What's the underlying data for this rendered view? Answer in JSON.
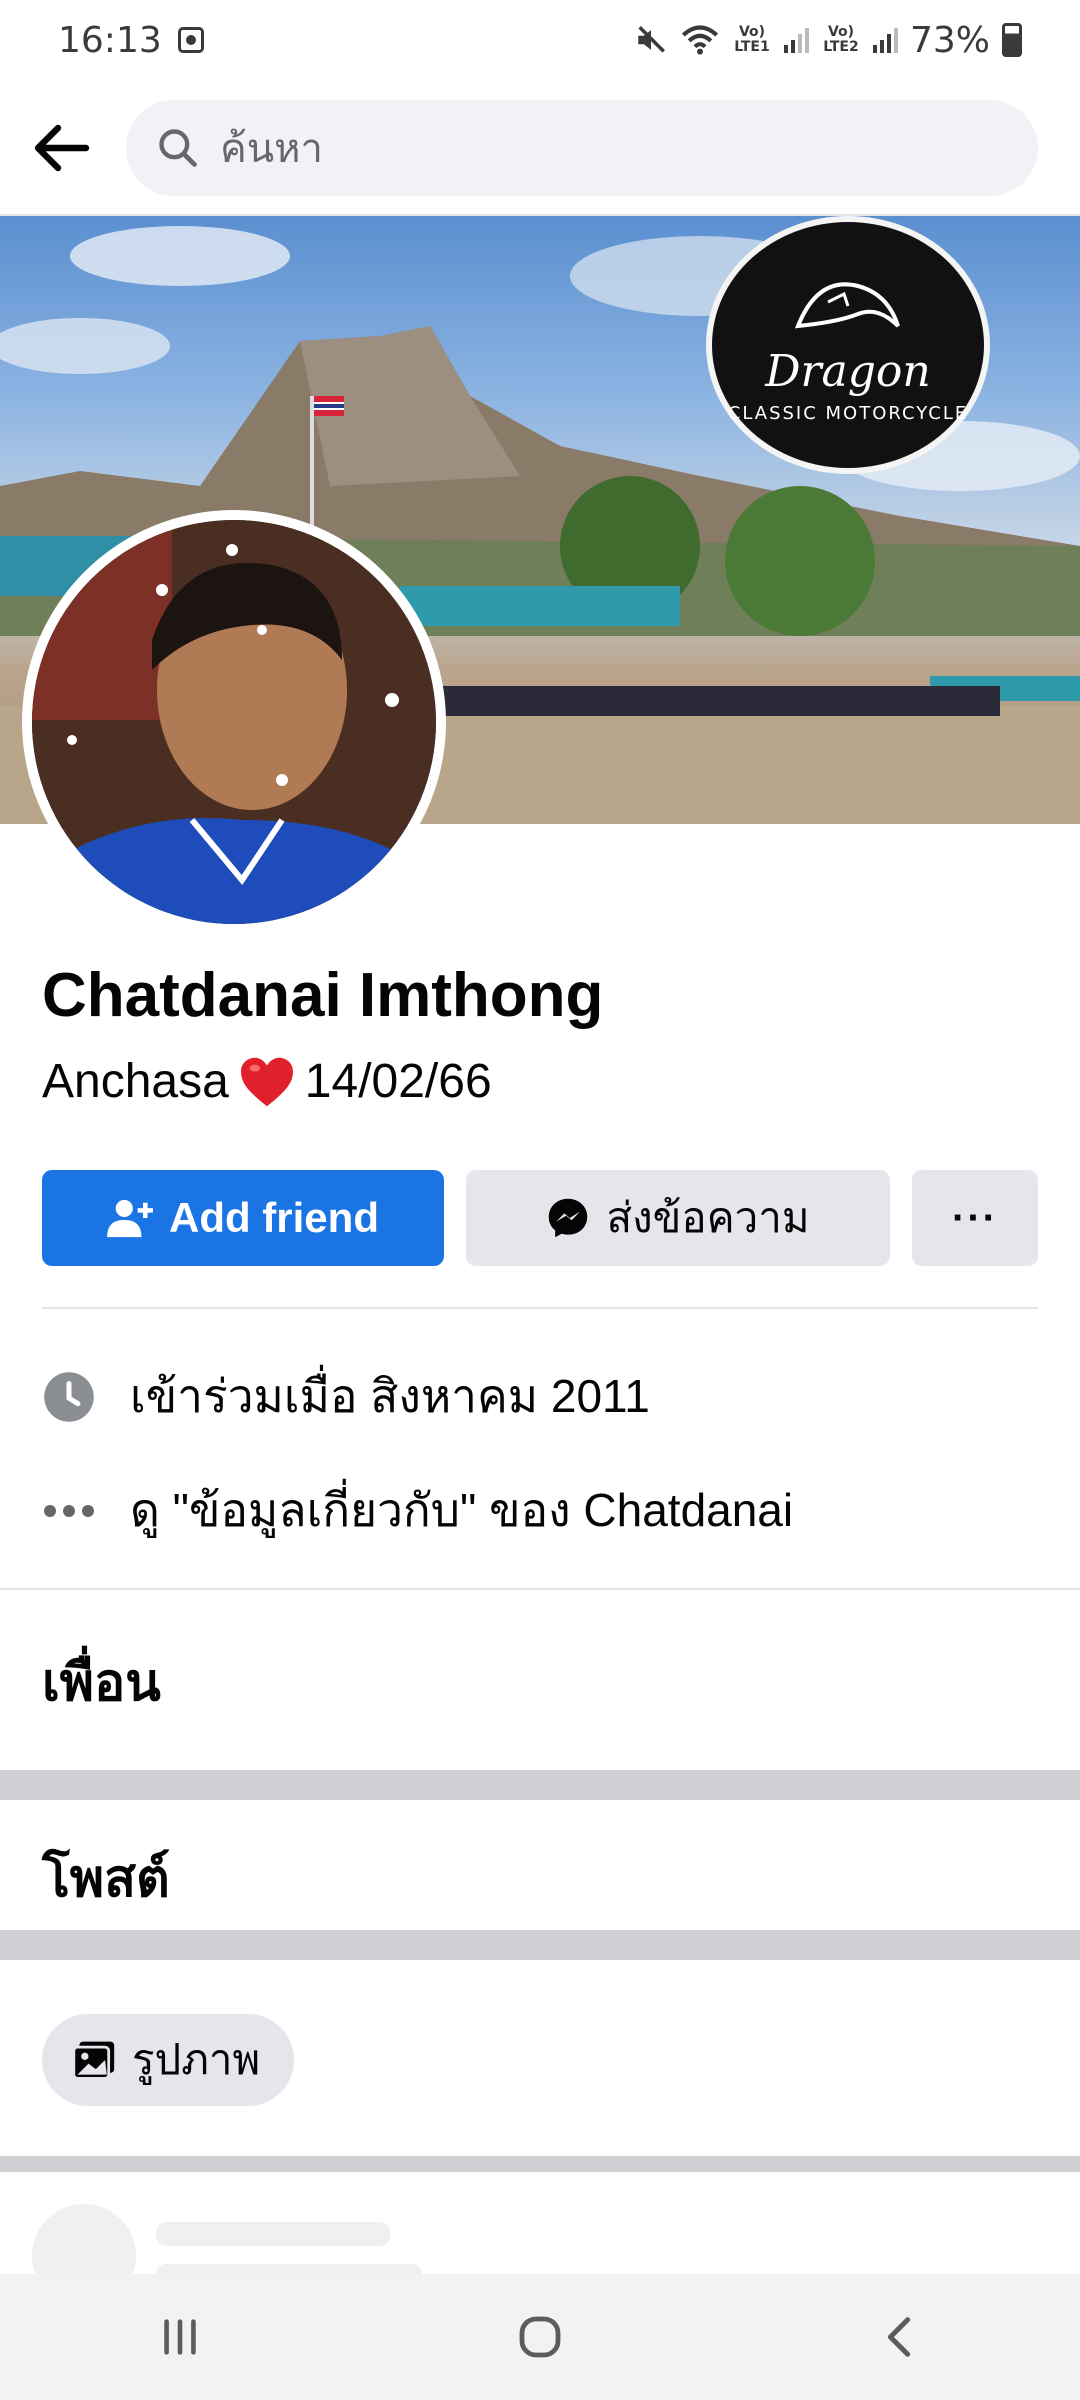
{
  "status_bar": {
    "time": "16:13",
    "sim1_label": "Vo) LTE1",
    "sim2_label": "Vo) LTE2",
    "battery": "73%",
    "battery_level": 0.73,
    "icons": [
      "screen-record-icon",
      "mute-icon",
      "wifi-icon",
      "signal-icon",
      "battery-icon"
    ]
  },
  "header": {
    "back_icon": "arrow-left-icon",
    "search_placeholder": "ค้นหา",
    "search_icon": "search-icon"
  },
  "profile": {
    "name": "Chatdanai Imthong",
    "bio_before": "Anchasa",
    "bio_emoji": "heart-icon",
    "bio_after": "14/02/66",
    "cover_badge_line1": "Dragon",
    "cover_badge_line2": "CLASSIC MOTORCYCLE"
  },
  "actions": {
    "add_friend": "Add friend",
    "message": "ส่งข้อความ",
    "more": "···",
    "accent": "#1b74e4"
  },
  "intro": {
    "joined": "เข้าร่วมเมื่อ สิงหาคม  2011",
    "about": "ดู \"ข้อมูลเกี่ยวกับ\" ของ Chatdanai"
  },
  "sections": {
    "friends": "เพื่อน",
    "posts": "โพสต์",
    "photos_chip": "รูปภาพ"
  },
  "nav": {
    "icons": [
      "recent-apps-icon",
      "home-icon",
      "back-icon"
    ]
  }
}
